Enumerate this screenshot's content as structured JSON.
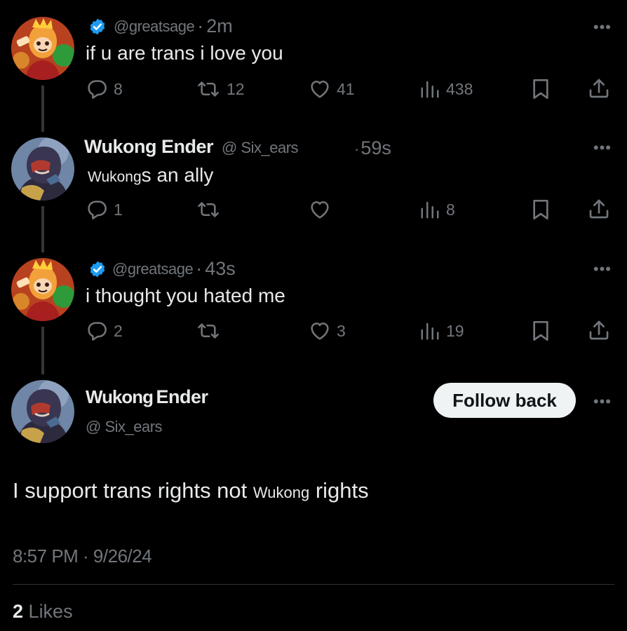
{
  "tweets": [
    {
      "handle": "@greatsage",
      "time": "2m",
      "text": "if u are trans i love you",
      "stats": {
        "replies": "8",
        "retweets": "12",
        "likes": "41",
        "views": "438"
      }
    },
    {
      "name": "Wukong Ender",
      "handle": "@ Six_ears",
      "time": "59s",
      "text_small": "Wukong",
      "text": "s an ally",
      "stats": {
        "replies": "1",
        "retweets": "",
        "likes": "",
        "views": "8"
      }
    },
    {
      "handle": "@greatsage",
      "time": "43s",
      "text": "i thought you hated me",
      "stats": {
        "replies": "2",
        "retweets": "",
        "likes": "3",
        "views": "19"
      }
    }
  ],
  "main": {
    "name_first": "Wukong",
    "name_second": "Ender",
    "handle": "@ Six_ears",
    "follow_label": "Follow back",
    "text_before": "I support trans rights not",
    "text_small": "Wukong",
    "text_after": "rights",
    "timestamp": "8:57 PM · 9/26/24",
    "likes_count": "2",
    "likes_label": "Likes"
  },
  "colors": {
    "background": "#000000",
    "text": "#e7e9ea",
    "muted": "#71767b",
    "verified": "#1d9bf0",
    "button": "#eff3f4"
  },
  "icons": [
    "verified-badge-icon",
    "reply-icon",
    "retweet-icon",
    "like-icon",
    "views-icon",
    "bookmark-icon",
    "share-icon",
    "more-icon"
  ]
}
